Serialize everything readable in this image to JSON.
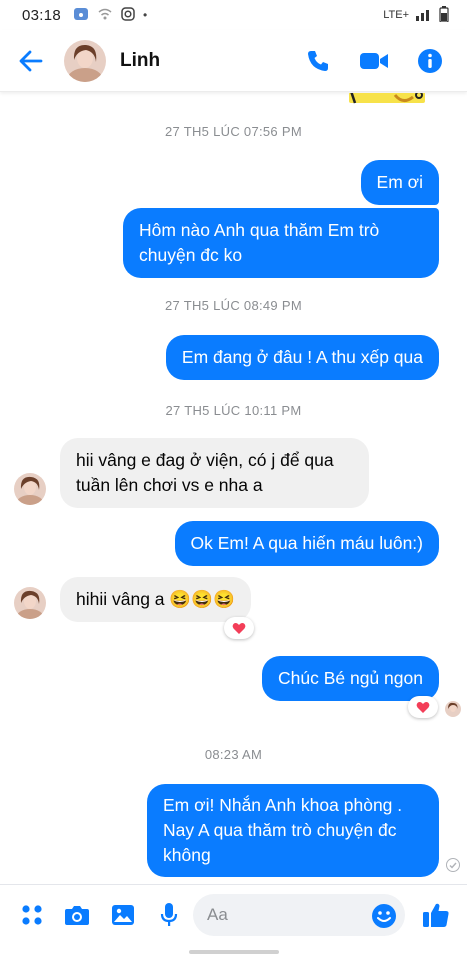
{
  "status": {
    "time": "03:18",
    "network": "LTE+"
  },
  "header": {
    "contact_name": "Linh",
    "brand_color": "#0a7cff"
  },
  "messages": [
    {
      "kind": "timestamp",
      "text": "27 TH5 LÚC 07:56 PM"
    },
    {
      "kind": "out",
      "text": "Em ơi"
    },
    {
      "kind": "out",
      "text": "Hôm nào Anh qua thăm Em trò chuyện đc ko"
    },
    {
      "kind": "timestamp",
      "text": "27 TH5 LÚC 08:49 PM"
    },
    {
      "kind": "out",
      "text": "Em đang ở đâu ! A thu xếp qua"
    },
    {
      "kind": "timestamp",
      "text": "27 TH5 LÚC 10:11 PM"
    },
    {
      "kind": "in",
      "text": "hii vâng e đag ở viện, có j để qua tuần lên chơi vs e nha a"
    },
    {
      "kind": "out",
      "text": "Ok Em! A qua hiến máu luôn:)"
    },
    {
      "kind": "in",
      "text": "hihii vâng a 😆😆😆",
      "reaction": "heart"
    },
    {
      "kind": "out",
      "text": "Chúc Bé ngủ ngon",
      "reaction": "heart",
      "seen": true
    },
    {
      "kind": "timestamp",
      "text": "08:23 AM"
    },
    {
      "kind": "out",
      "text": "Em ơi! Nhắn Anh khoa phòng . Nay A qua thăm trò chuyện đc không",
      "status_icon": "sent-check"
    }
  ],
  "composer": {
    "placeholder": "Aa",
    "icons": [
      "menu-dots-icon",
      "camera-icon",
      "image-icon",
      "microphone-icon",
      "emoji-icon",
      "like-icon"
    ]
  },
  "colors": {
    "outgoing": "#0a7cff",
    "incoming": "#f0f0f0",
    "timestamp": "#8a8d91",
    "reaction": "#f33e58"
  }
}
